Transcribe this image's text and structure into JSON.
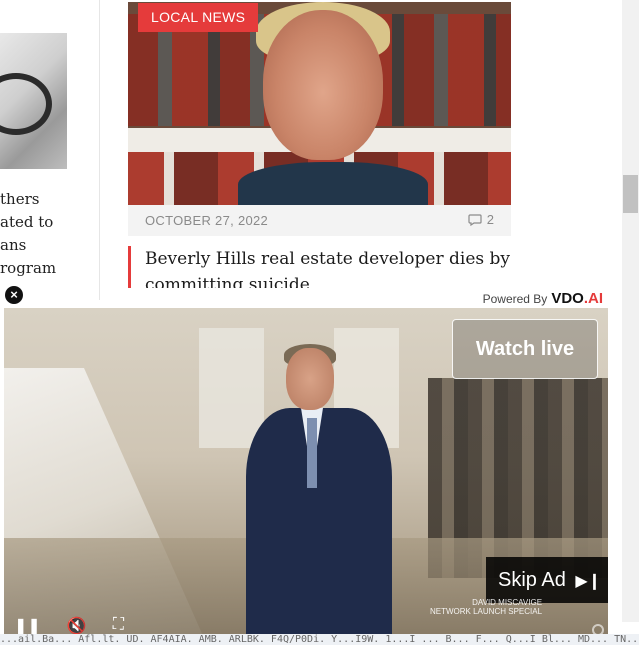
{
  "left_article": {
    "lines": [
      "thers",
      "ated to",
      "ans",
      "rogram"
    ]
  },
  "main_article": {
    "category_badge": "LOCAL NEWS",
    "date": "OCTOBER 27, 2022",
    "comment_count": "2",
    "headline": "Beverly Hills real estate developer dies by committing suicide"
  },
  "ad": {
    "close_label": "×",
    "powered_by": "Powered By",
    "brand": "VDO",
    "brand_suffix": ".AI",
    "watch_live": "Watch live",
    "skip_ad": "Skip Ad",
    "watermark_line1": "DAVID MISCAVIGE",
    "watermark_line2": "NETWORK LAUNCH SPECIAL",
    "controls": {
      "play": "❚❚",
      "mute": "🔇",
      "fullscreen": "⛶"
    }
  },
  "status_bar": {
    "text": "...ail.Ba... Afl.lt. UD. AF4AIA. AMB. ARLBK. F4Q/P0Di. Y...I9W. 1...I ... B... F... Q...I Bl... MD... TN... N"
  },
  "colors": {
    "accent": "#e53b3b"
  }
}
